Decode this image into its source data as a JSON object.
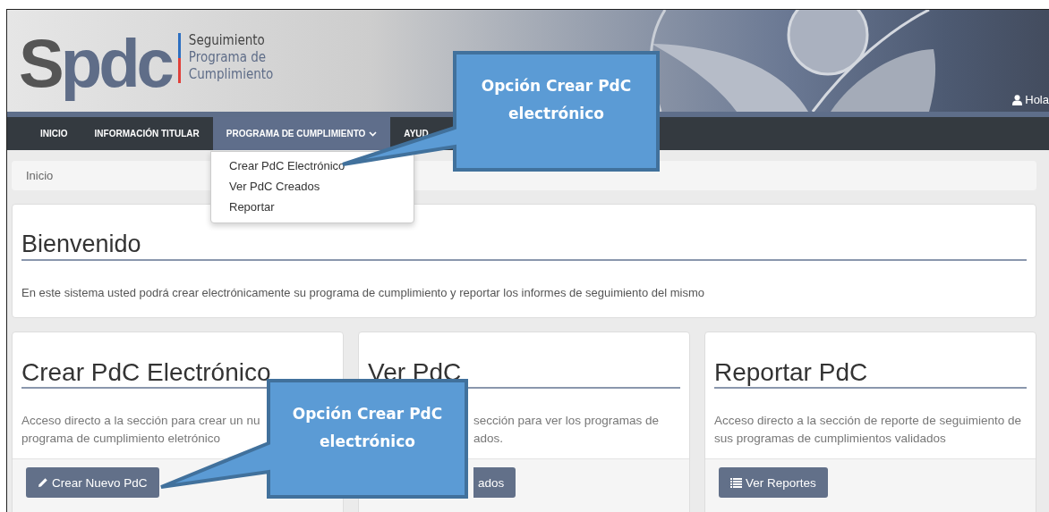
{
  "header": {
    "logo": {
      "text": "Spdc",
      "lines": [
        "Seguimiento",
        "Programa de",
        "Cumplimiento"
      ]
    },
    "user": {
      "greeting": "Hola"
    }
  },
  "nav": {
    "items": [
      {
        "label": "INICIO",
        "selected": false,
        "has_menu": false
      },
      {
        "label": "INFORMACIÓN TITULAR",
        "selected": false,
        "has_menu": false
      },
      {
        "label": "PROGRAMA DE CUMPLIMIENTO",
        "selected": true,
        "has_menu": true
      },
      {
        "label": "AYUD",
        "selected": false,
        "has_menu": false
      }
    ],
    "dropdown": [
      "Crear PdC Electrónico",
      "Ver PdC Creados",
      "Reportar"
    ]
  },
  "breadcrumb": "Inicio",
  "welcome": {
    "title": "Bienvenido",
    "text": "En este sistema usted podrá crear electrónicamente su programa de cumplimiento y reportar los informes de seguimiento del mismo"
  },
  "cards": [
    {
      "title": "Crear PdC Electrónico",
      "covered": false,
      "description_lines": [
        "Acceso directo a la sección para crear un nu",
        "programa de cumplimiento eletrónico"
      ],
      "button": {
        "label": "Crear Nuevo PdC"
      }
    },
    {
      "title": "Ver PdC",
      "covered": true,
      "description_lines": [
        "sección para ver los programas de",
        "ados."
      ],
      "button": {
        "label": "ados"
      }
    },
    {
      "title": "Reportar PdC",
      "covered": false,
      "description_lines": [
        "Acceso directo a la sección de reporte de seguimiento de",
        "sus programas de cumplimientos validados"
      ],
      "button": {
        "label": "Ver Reportes"
      }
    }
  ],
  "callouts": [
    {
      "text": "Opción Crear PdC electrónico"
    },
    {
      "text": "Opción Crear PdC electrónico"
    }
  ]
}
